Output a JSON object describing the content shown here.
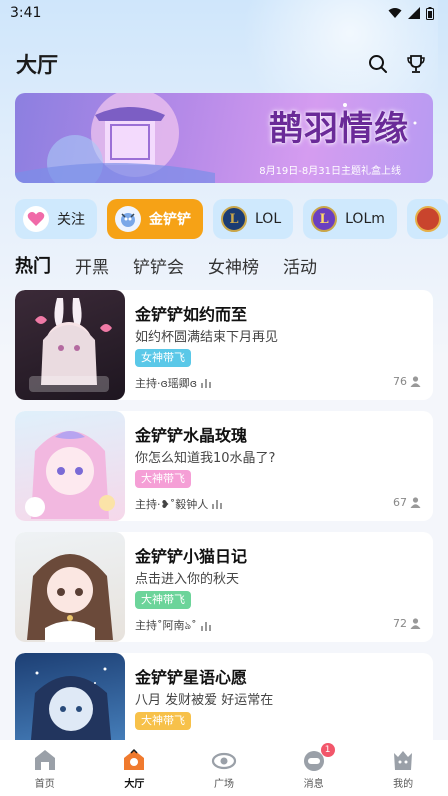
{
  "status": {
    "time": "3:41"
  },
  "header": {
    "title": "大厅"
  },
  "banner": {
    "title": "鹊羽情缘",
    "subtitle": "8月19日-8月31日主题礼盒上线"
  },
  "categories": [
    {
      "label": "关注",
      "icon": "heart-icon"
    },
    {
      "label": "金铲铲",
      "icon": "tft-icon",
      "active": true
    },
    {
      "label": "LOL",
      "icon": "lol-icon"
    },
    {
      "label": "LOLm",
      "icon": "lolm-icon"
    },
    {
      "label": "",
      "icon": "game-avatar-icon"
    }
  ],
  "tabs": [
    "热门",
    "开黑",
    "铲铲会",
    "女神榜",
    "活动"
  ],
  "rooms": [
    {
      "title": "金铲铲如约而至",
      "desc": "如约杯圆满结束下月再见",
      "tag": "女神带飞",
      "tag_color": "#5ac8e8",
      "host": "主持·ɞ瑶卿ɞ",
      "count": "76"
    },
    {
      "title": "金铲铲水晶玫瑰",
      "desc": "你怎么知道我10水晶了?",
      "tag": "大神带飞",
      "tag_color": "#f59fd6",
      "host": "主持·❥˚毅钟人",
      "count": "67"
    },
    {
      "title": "金铲铲小猫日记",
      "desc": "点击进入你的秋天",
      "tag": "大神带飞",
      "tag_color": "#6cd49a",
      "host": "主持˚阿南ঌ˚",
      "count": "72"
    },
    {
      "title": "金铲铲星语心愿",
      "desc": "八月 发财被爱 好运常在",
      "tag": "大神带飞",
      "tag_color": "#f7c14a",
      "host": "",
      "count": ""
    }
  ],
  "nav": [
    {
      "label": "首页",
      "icon": "home-icon"
    },
    {
      "label": "大厅",
      "icon": "lobby-icon",
      "active": true
    },
    {
      "label": "广场",
      "icon": "square-icon"
    },
    {
      "label": "消息",
      "icon": "message-icon",
      "badge": "1"
    },
    {
      "label": "我的",
      "icon": "profile-icon"
    }
  ]
}
